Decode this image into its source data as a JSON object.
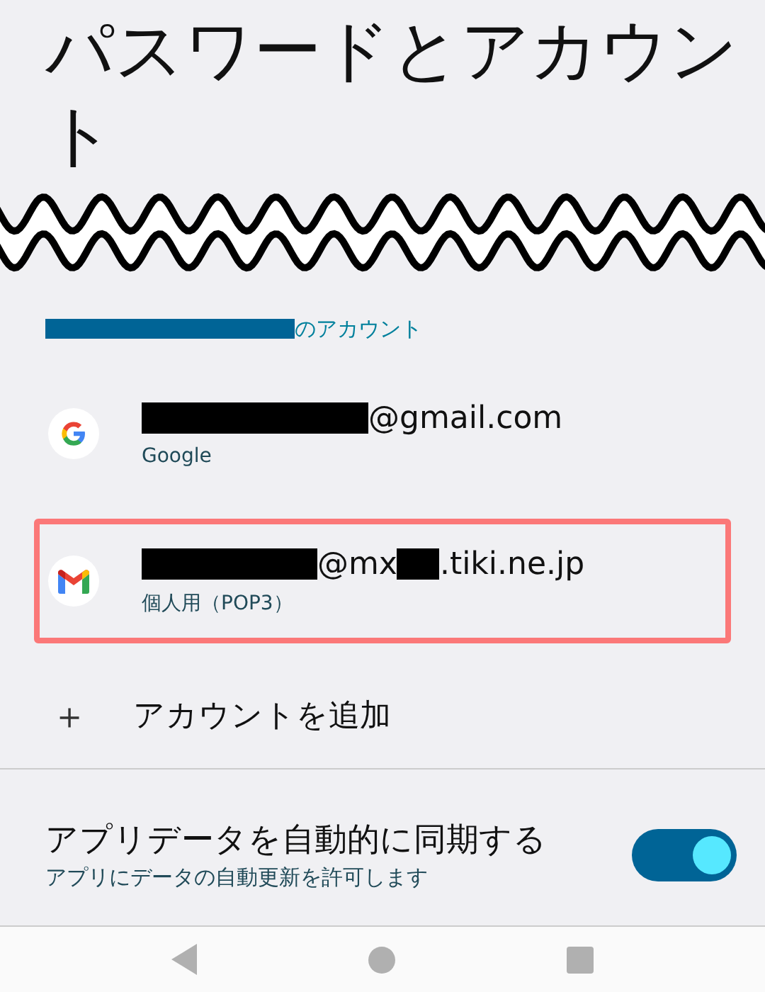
{
  "title": "パスワードとアカウント",
  "section": {
    "label_parts": [
      {
        "kind": "redacted"
      },
      {
        "kind": "text",
        "text": "のアカウント"
      }
    ]
  },
  "accounts": [
    {
      "email_parts": [
        {
          "kind": "redacted"
        },
        {
          "kind": "text",
          "text": "@gmail.com"
        }
      ],
      "type": "Google",
      "highlighted": false
    },
    {
      "email_parts": [
        {
          "kind": "redacted"
        },
        {
          "kind": "text",
          "text": "@mx"
        },
        {
          "kind": "redacted"
        },
        {
          "kind": "text",
          "text": ".tiki.ne.jp"
        }
      ],
      "type": "個人用（POP3）",
      "highlighted": true
    }
  ],
  "add_account": {
    "icon": "＋",
    "label": "アカウントを追加"
  },
  "sync": {
    "title": "アプリデータを自動的に同期する",
    "subtitle": "アプリにデータの自動更新を許可します",
    "on": true
  }
}
